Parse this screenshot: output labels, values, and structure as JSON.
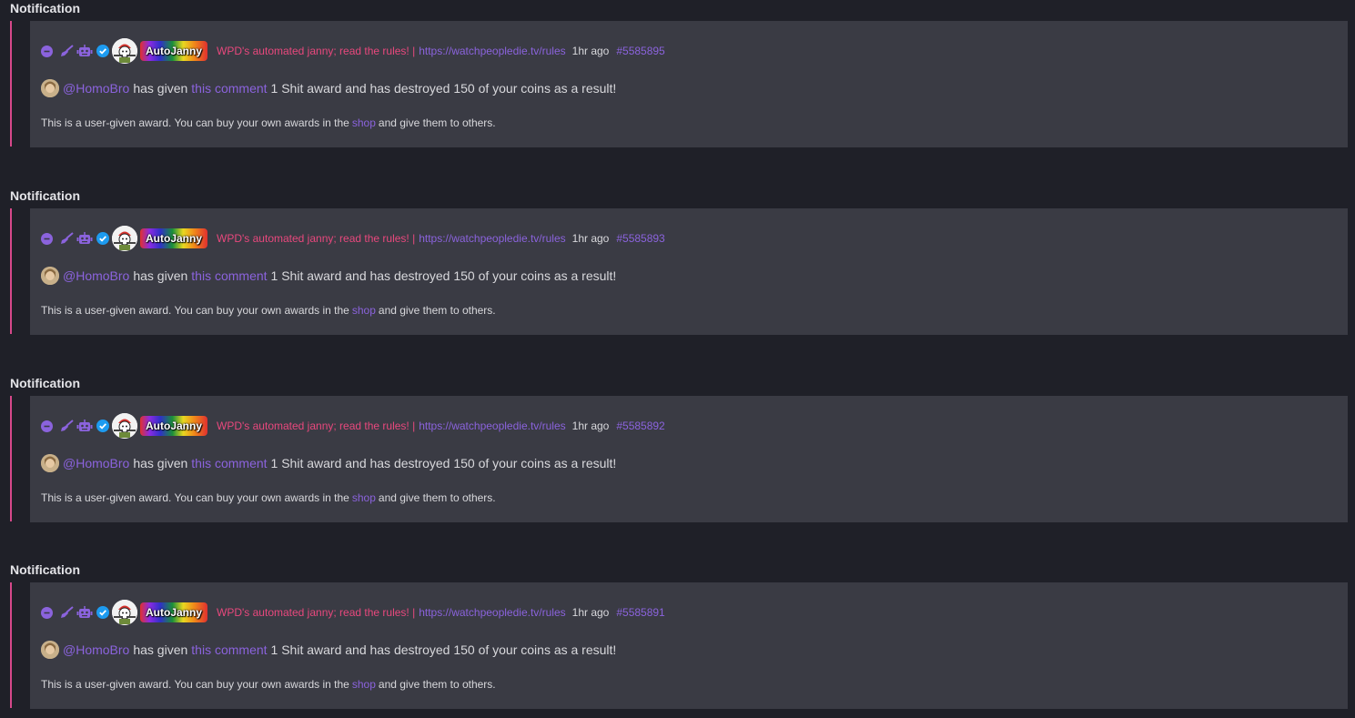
{
  "notifications": [
    {
      "heading": "Notification",
      "author": "AutoJanny",
      "bio": "WPD's automated janny; read the rules! |",
      "bio_link": "https://watchpeopledie.tv/rules",
      "time": "1hr ago",
      "id": "#5585895",
      "mention": "@HomoBro",
      "verb": "has given",
      "link_text": "this comment",
      "message": "1 Shit award and has destroyed 150 of your coins as a result!",
      "footer_before": "This is a user-given award. You can buy your own awards in the",
      "footer_link": "shop",
      "footer_after": "and give them to others."
    },
    {
      "heading": "Notification",
      "author": "AutoJanny",
      "bio": "WPD's automated janny; read the rules! |",
      "bio_link": "https://watchpeopledie.tv/rules",
      "time": "1hr ago",
      "id": "#5585893",
      "mention": "@HomoBro",
      "verb": "has given",
      "link_text": "this comment",
      "message": "1 Shit award and has destroyed 150 of your coins as a result!",
      "footer_before": "This is a user-given award. You can buy your own awards in the",
      "footer_link": "shop",
      "footer_after": "and give them to others."
    },
    {
      "heading": "Notification",
      "author": "AutoJanny",
      "bio": "WPD's automated janny; read the rules! |",
      "bio_link": "https://watchpeopledie.tv/rules",
      "time": "1hr ago",
      "id": "#5585892",
      "mention": "@HomoBro",
      "verb": "has given",
      "link_text": "this comment",
      "message": "1 Shit award and has destroyed 150 of your coins as a result!",
      "footer_before": "This is a user-given award. You can buy your own awards in the",
      "footer_link": "shop",
      "footer_after": "and give them to others."
    },
    {
      "heading": "Notification",
      "author": "AutoJanny",
      "bio": "WPD's automated janny; read the rules! |",
      "bio_link": "https://watchpeopledie.tv/rules",
      "time": "1hr ago",
      "id": "#5585891",
      "mention": "@HomoBro",
      "verb": "has given",
      "link_text": "this comment",
      "message": "1 Shit award and has destroyed 150 of your coins as a result!",
      "footer_before": "This is a user-given award. You can buy your own awards in the",
      "footer_link": "shop",
      "footer_after": "and give them to others."
    }
  ],
  "icons": {
    "collapse": "minus-circle-icon",
    "janitor": "broom-icon",
    "bot": "robot-icon",
    "verified": "verified-check-icon"
  },
  "colors": {
    "background": "#1f2028",
    "card": "#3a3b44",
    "accent_bar": "#d6488a",
    "link": "#8b63dd",
    "bio": "#e8487d",
    "verified": "#1d9bf0"
  }
}
